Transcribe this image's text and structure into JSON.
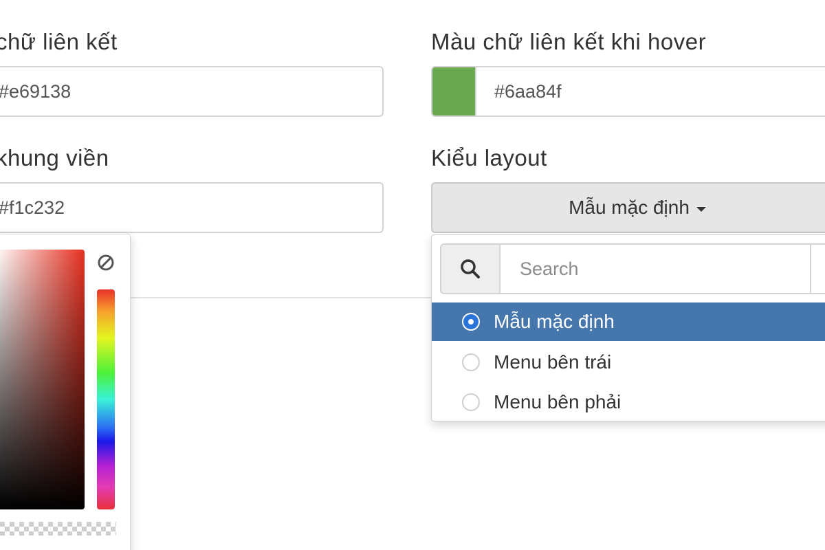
{
  "fields": {
    "link_color": {
      "label": "chữ liên kết",
      "value": "#e69138"
    },
    "link_hover_color": {
      "label": "Màu chữ liên kết khi hover",
      "value": "#6aa84f",
      "swatch": "#6aa84f"
    },
    "border_color": {
      "label": "khung viền",
      "value": "#f1c232"
    },
    "layout": {
      "label": "Kiểu layout",
      "selected": "Mẫu mặc định"
    }
  },
  "dropdown": {
    "search_placeholder": "Search",
    "options": [
      {
        "label": "Mẫu mặc định",
        "checked": true
      },
      {
        "label": "Menu bên trái",
        "checked": false
      },
      {
        "label": "Menu bên phải",
        "checked": false
      }
    ]
  },
  "colors": {
    "active_option_bg": "#4577ad",
    "picker_hue": "#e53020"
  },
  "icons": {
    "search": "search-icon",
    "clear_color": "no-color-icon",
    "caret": "caret-down-icon"
  }
}
